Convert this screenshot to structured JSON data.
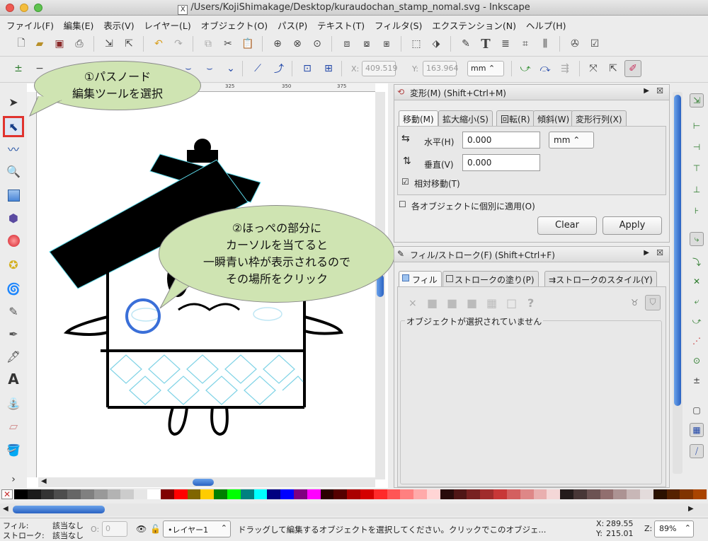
{
  "window": {
    "title": "/Users/KojiShimakage/Desktop/kuraudochan_stamp_nomal.svg - Inkscape",
    "title_icon": "X"
  },
  "menu": [
    "ファイル(F)",
    "編集(E)",
    "表示(V)",
    "レイヤー(L)",
    "オブジェクト(O)",
    "パス(P)",
    "テキスト(T)",
    "フィルタ(S)",
    "エクステンション(N)",
    "ヘルプ(H)"
  ],
  "tool_controls": {
    "x_label": "X:",
    "x_value": "409.519",
    "y_label": "Y:",
    "y_value": "163.964",
    "unit": "mm"
  },
  "ruler_ticks": [
    "325",
    "350",
    "375"
  ],
  "callouts": {
    "tool_note": [
      "①パスノード",
      "編集ツールを選択"
    ],
    "cheek_note": [
      "②ほっぺの部分に",
      "カーソルを当てると",
      "一瞬青い枠が表示されるので",
      "その場所をクリック"
    ]
  },
  "transform_dialog": {
    "title": "変形(M) (Shift+Ctrl+M)",
    "tabs": [
      "移動(M)",
      "拡大縮小(S)",
      "回転(R)",
      "傾斜(W)",
      "変形行列(X)"
    ],
    "horizontal_label": "水平(H)",
    "horizontal_value": "0.000",
    "vertical_label": "垂直(V)",
    "vertical_value": "0.000",
    "unit": "mm",
    "relative_move_label": "相対移動(T)",
    "apply_each_label": "各オブジェクトに個別に適用(O)",
    "clear_label": "Clear",
    "apply_label": "Apply"
  },
  "fill_stroke_dialog": {
    "title": "フィル/ストローク(F) (Shift+Ctrl+F)",
    "tabs": [
      "フィル",
      "ストロークの塗り(P)",
      "ストロークのスタイル(Y)"
    ],
    "paint_icons": [
      "×",
      "■",
      "■",
      "■",
      "▦",
      "□",
      "?"
    ],
    "no_selection": "オブジェクトが選択されていません"
  },
  "status": {
    "fill_label": "フィル:",
    "fill_value": "該当なし",
    "stroke_label": "ストローク:",
    "stroke_value": "該当なし",
    "opacity_label": "O:",
    "opacity_value": "0",
    "layer": "•レイヤー1",
    "message": "ドラッグして編集するオブジェクトを選択してください。クリックでこのオブジェ...",
    "x_label": "X:",
    "x_value": "289.55",
    "y_label": "Y:",
    "y_value": "215.01",
    "z_label": "Z:",
    "zoom": "89%"
  },
  "colors": {
    "highlight": "#e0332e",
    "callout_fill": "#cfe4b2",
    "cheek_ring": "#3a6fd8",
    "node_cyan": "#5ad6e6",
    "palette": [
      "#000000",
      "#1a1a1a",
      "#333333",
      "#4d4d4d",
      "#666666",
      "#808080",
      "#999999",
      "#b3b3b3",
      "#cccccc",
      "#e6e6e6",
      "#ffffff",
      "#800000",
      "#ff0000",
      "#806600",
      "#ffcc00",
      "#008000",
      "#00ff00",
      "#008080",
      "#00ffff",
      "#000080",
      "#0000ff",
      "#800080",
      "#ff00ff",
      "#2b0000",
      "#550000",
      "#aa0000",
      "#d40000",
      "#ff2a2a",
      "#ff5555",
      "#ff8080",
      "#ffaaaa",
      "#ffd5d5",
      "#280b0b",
      "#501616",
      "#782121",
      "#a02c2c",
      "#c83737",
      "#d35f5f",
      "#de8787",
      "#e9afaf",
      "#f4d7d7",
      "#241c1c",
      "#483737",
      "#6c5353",
      "#916f6f",
      "#ac9393",
      "#c8b7b7",
      "#e3dbdb",
      "#2b1100",
      "#552200",
      "#803300",
      "#aa4400"
    ]
  }
}
